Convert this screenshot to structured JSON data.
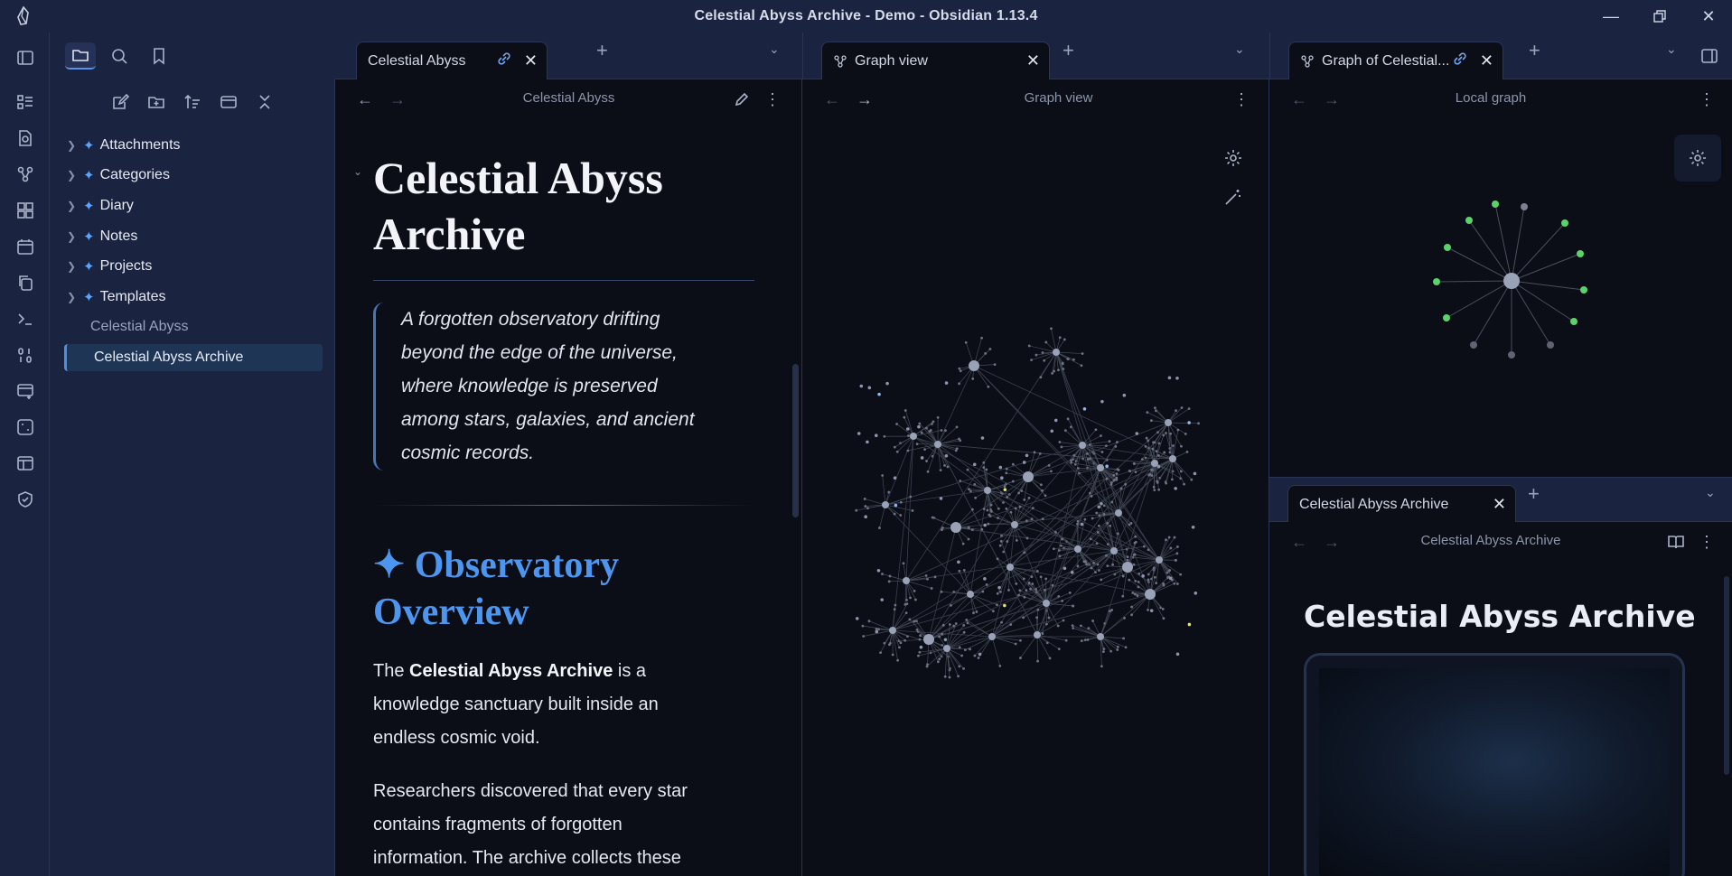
{
  "window": {
    "title": "Celestial Abyss Archive - Demo - Obsidian 1.13.4"
  },
  "ribbon": {
    "icons": [
      "sidebar-toggle-icon",
      "dashboard-icon",
      "search-file-icon",
      "graph-icon",
      "grid-icon",
      "calendar-icon",
      "copy-icon",
      "terminal-icon",
      "binary-icon",
      "add-table-icon",
      "dice-icon",
      "layout-icon",
      "shield-icon"
    ]
  },
  "left_sidebar": {
    "tabs": [
      "folder-icon",
      "search-icon",
      "bookmark-icon"
    ],
    "toolbar": [
      "new-note-icon",
      "new-folder-icon",
      "sort-icon",
      "collapse-view-icon",
      "collapse-all-icon"
    ],
    "folders": [
      {
        "label": "Attachments"
      },
      {
        "label": "Categories"
      },
      {
        "label": "Diary"
      },
      {
        "label": "Notes"
      },
      {
        "label": "Projects"
      },
      {
        "label": "Templates"
      }
    ],
    "files": [
      {
        "label": "Celestial Abyss"
      },
      {
        "label": "Celestial Abyss Archive"
      }
    ]
  },
  "pane1": {
    "tab_label": "Celestial Abyss",
    "header_title": "Celestial Abyss",
    "h1_line1": "Celestial Abyss",
    "h1_line2": "Archive",
    "quote_lines": [
      "A forgotten observatory drifting",
      "beyond the edge of the universe,",
      "where knowledge is preserved",
      "among stars, galaxies, and ancient",
      "cosmic records."
    ],
    "h2_line1": "✦ Observatory",
    "h2_line2": "Overview",
    "p1_a": "The ",
    "p1_b": "Celestial Abyss Archive",
    "p1_c": " is a",
    "p1_line2": "knowledge sanctuary built inside an",
    "p1_line3": "endless cosmic void.",
    "p2_line1": "Researchers discovered that every star",
    "p2_line2": "contains fragments of forgotten",
    "p2_line3": "information. The archive collects these"
  },
  "pane2": {
    "tab_label": "Graph view",
    "header_title": "Graph view"
  },
  "pane3": {
    "tab_label": "Graph of Celestial...",
    "header_title": "Local graph"
  },
  "pane4": {
    "tab_label": "Celestial Abyss Archive",
    "header_title": "Celestial Abyss Archive",
    "h1": "Celestial Abyss Archive"
  },
  "colors": {
    "accent": "#4d96f0",
    "background": "#0b0e16",
    "chrome": "#1a2340",
    "graph_node": "#8d95ad",
    "local_graph_link": "#5ad36a"
  }
}
